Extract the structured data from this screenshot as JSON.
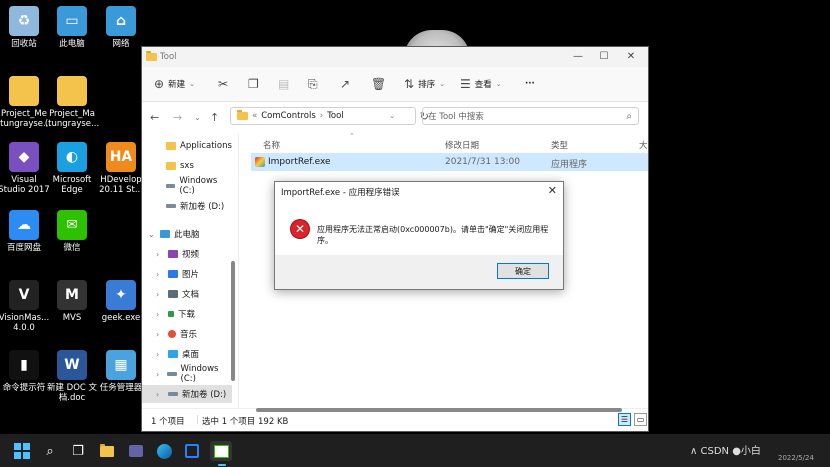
{
  "desktop": {
    "icons": [
      {
        "label": "回收站",
        "icon": "recycle-bin-icon",
        "color": "#8fb8de"
      },
      {
        "label": "此电脑",
        "icon": "computer-icon",
        "color": "#3a9ad9"
      },
      {
        "label": "网络",
        "icon": "network-icon",
        "color": "#3a9ad9"
      },
      {
        "label": "Project_Me\n(tungrayse...",
        "icon": "folder-icon",
        "color": "#f3c34c"
      },
      {
        "label": "Project_Ma\n(tungrayse...",
        "icon": "folder-icon",
        "color": "#f3c34c"
      },
      {
        "label": "Visual\nStudio 2017",
        "icon": "visual-studio-icon",
        "color": "#7a4fbf"
      },
      {
        "label": "Microsoft\nEdge",
        "icon": "edge-icon",
        "color": "#1aa0e0"
      },
      {
        "label": "HDevelop\n20.11 St...",
        "icon": "hdevelop-icon",
        "color": "#f08a1c"
      },
      {
        "label": "百度网盘",
        "icon": "baidu-netdisk-icon",
        "color": "#2c8cf4"
      },
      {
        "label": "微信",
        "icon": "wechat-icon",
        "color": "#2dc100"
      },
      {
        "label": "VisionMas...\n4.0.0",
        "icon": "visionmaster-icon",
        "color": "#222222"
      },
      {
        "label": "MVS",
        "icon": "mvs-icon",
        "color": "#333333"
      },
      {
        "label": "geek.exe",
        "icon": "geek-icon",
        "color": "#3a7bd5"
      },
      {
        "label": "命令提示符",
        "icon": "cmd-icon",
        "color": "#111111"
      },
      {
        "label": "新建 DOC 文\n档.doc",
        "icon": "doc-icon",
        "color": "#2b579a"
      },
      {
        "label": "任务管理器",
        "icon": "task-manager-icon",
        "color": "#4aa3df"
      }
    ]
  },
  "explorer": {
    "title": "Tool",
    "toolbar": {
      "new_label": "新建",
      "sort_label": "排序",
      "view_label": "查看",
      "more_label": "···"
    },
    "address": {
      "prefix": "«",
      "crumb1": "ComControls",
      "sep": "›",
      "crumb2": "Tool",
      "search_placeholder": "在 Tool 中搜索"
    },
    "sidebar": {
      "items": [
        {
          "label": "Applications"
        },
        {
          "label": "sxs"
        },
        {
          "label": "Windows (C:)"
        },
        {
          "label": "新加卷 (D:)"
        },
        {
          "label": "此电脑"
        },
        {
          "label": "视频"
        },
        {
          "label": "图片"
        },
        {
          "label": "文档"
        },
        {
          "label": "下载"
        },
        {
          "label": "音乐"
        },
        {
          "label": "桌面"
        },
        {
          "label": "Windows (C:)"
        },
        {
          "label": "新加卷 (D:)"
        }
      ]
    },
    "columns": {
      "name": "名称",
      "date": "修改日期",
      "type": "类型",
      "size": "大小"
    },
    "files": [
      {
        "name": "ImportRef.exe",
        "date": "2021/7/31 13:00",
        "type": "应用程序"
      }
    ],
    "status": {
      "count": "1 个项目",
      "selected": "选中 1 个项目  192 KB"
    }
  },
  "dialog": {
    "title": "ImportRef.exe - 应用程序错误",
    "message": "应用程序无法正常启动(0xc000007b)。请单击\"确定\"关闭应用程序。",
    "ok_label": "确定"
  },
  "taskbar": {
    "tray_text": "∧ CSDN ●小白",
    "clock": "2022/5/24"
  }
}
